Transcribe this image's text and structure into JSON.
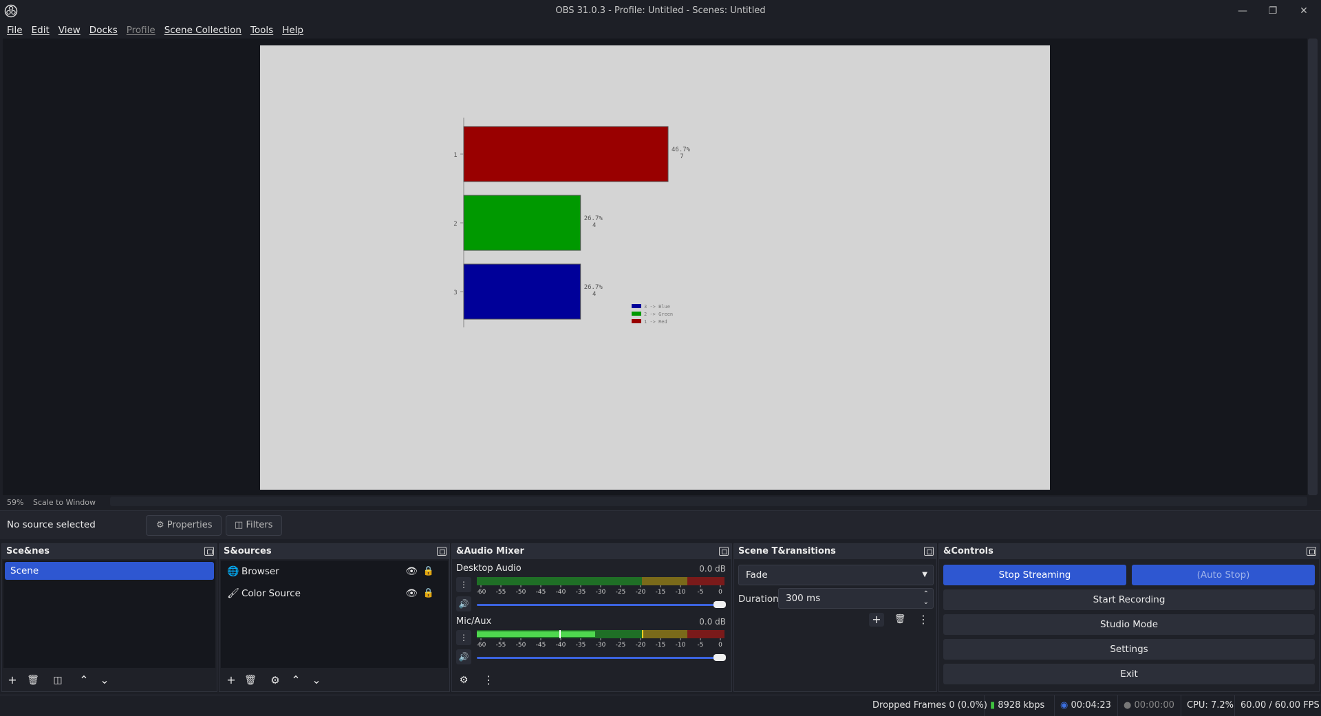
{
  "window": {
    "title": "OBS 31.0.3 - Profile: Untitled - Scenes: Untitled",
    "minimize_icon": "minimize-icon",
    "maximize_icon": "restore-icon",
    "close_icon": "close-icon"
  },
  "menubar": {
    "items": [
      "File",
      "Edit",
      "View",
      "Docks",
      "Profile",
      "Scene Collection",
      "Tools",
      "Help"
    ],
    "disabled": [
      "Profile"
    ]
  },
  "preview": {
    "zoom": "59%",
    "scale_mode": "Scale to Window",
    "chart": {
      "bars": [
        {
          "category": "1",
          "pct_label": "46.7%",
          "count_label": "7",
          "color": "#990000",
          "value": 7
        },
        {
          "category": "2",
          "pct_label": "26.7%",
          "count_label": "4",
          "color": "#009900",
          "value": 4
        },
        {
          "category": "3",
          "pct_label": "26.7%",
          "count_label": "4",
          "color": "#000099",
          "value": 4
        }
      ],
      "legend": [
        "3 -> Blue",
        "2 -> Green",
        "1 -> Red"
      ],
      "legend_colors": [
        "#000099",
        "#009900",
        "#990000"
      ]
    }
  },
  "source_toolbar": {
    "status": "No source selected",
    "properties_label": "Properties",
    "filters_label": "Filters"
  },
  "scenes": {
    "title": "Sce&nes",
    "items": [
      "Scene"
    ]
  },
  "sources": {
    "title": "S&ources",
    "items": [
      {
        "label": "Browser",
        "icon": "globe-icon"
      },
      {
        "label": "Color Source",
        "icon": "paintbrush-icon"
      }
    ]
  },
  "audio_mixer": {
    "title": "&Audio Mixer",
    "ticks": [
      "-60",
      "-55",
      "-50",
      "-45",
      "-40",
      "-35",
      "-30",
      "-25",
      "-20",
      "-15",
      "-10",
      "-5",
      "0"
    ],
    "channels": [
      {
        "name": "Desktop Audio",
        "db": "0.0 dB",
        "level": 0,
        "volume": 1.0
      },
      {
        "name": "Mic/Aux",
        "db": "0.0 dB",
        "level": 0.48,
        "volume": 1.0
      }
    ]
  },
  "transitions": {
    "title": "Scene T&ransitions",
    "selected": "Fade",
    "duration_label": "Duration",
    "duration_value": "300 ms"
  },
  "controls": {
    "title": "&Controls",
    "stop_streaming": "Stop Streaming",
    "auto_stop": "(Auto Stop)",
    "start_recording": "Start Recording",
    "studio_mode": "Studio Mode",
    "settings": "Settings",
    "exit": "Exit"
  },
  "status": {
    "dropped_frames": "Dropped Frames 0 (0.0%)",
    "bitrate": "8928 kbps",
    "stream_time": "00:04:23",
    "record_time": "00:00:00",
    "cpu": "CPU: 7.2%",
    "fps": "60.00 / 60.00 FPS",
    "colors": {
      "bitrate": "#3fc23f",
      "stream": "#3b6fe0",
      "record": "#777777"
    }
  }
}
